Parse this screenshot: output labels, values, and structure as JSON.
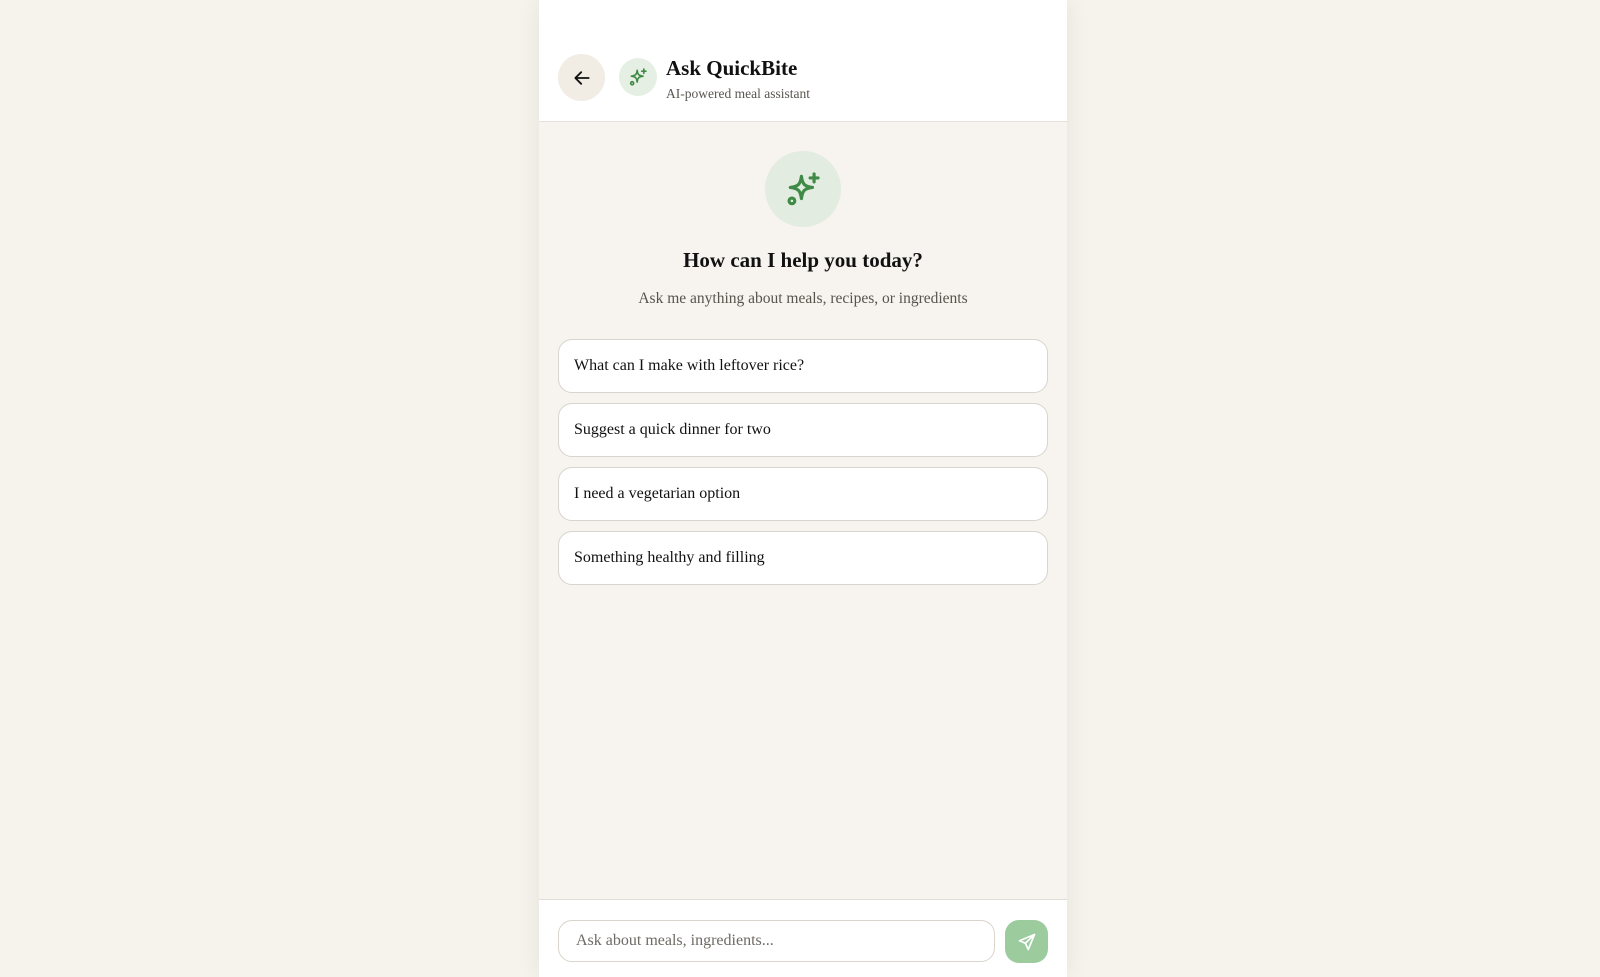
{
  "header": {
    "title": "Ask QuickBite",
    "subtitle": "AI-powered meal assistant",
    "back_icon": "arrow-left-icon",
    "avatar_icon": "sparkles-icon"
  },
  "hero": {
    "icon": "sparkles-icon",
    "title": "How can I help you today?",
    "subtitle": "Ask me anything about meals, recipes, or ingredients"
  },
  "suggestions": [
    "What can I make with leftover rice?",
    "Suggest a quick dinner for two",
    "I need a vegetarian option",
    "Something healthy and filling"
  ],
  "composer": {
    "placeholder": "Ask about meals, ingredients...",
    "value": "",
    "send_icon": "send-icon"
  },
  "colors": {
    "page_background": "#f6f2ec",
    "accent_green": "#3f8a46",
    "send_button": "#9ccb9e",
    "icon_circle": "#e3ece0"
  }
}
